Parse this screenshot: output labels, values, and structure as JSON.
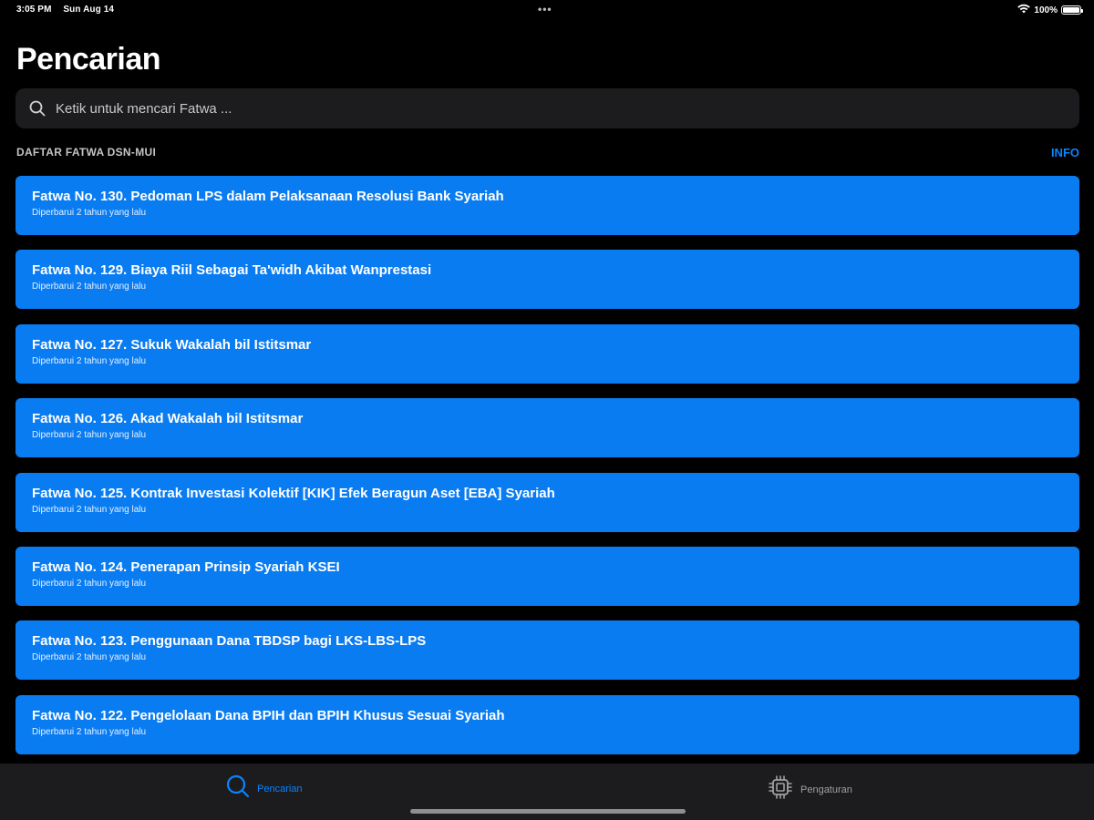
{
  "status_bar": {
    "time": "3:05 PM",
    "date": "Sun Aug 14",
    "dots": "•••",
    "battery": "100%",
    "battery_level": 1.0
  },
  "page": {
    "title": "Pencarian"
  },
  "search": {
    "placeholder": "Ketik untuk mencari Fatwa ...",
    "value": "",
    "icon": "search-icon"
  },
  "section": {
    "title": "DAFTAR FATWA DSN-MUI",
    "action": "INFO"
  },
  "fatwa_list": [
    {
      "title": "Fatwa No. 130. Pedoman LPS dalam Pelaksanaan Resolusi Bank Syariah",
      "subtitle": "Diperbarui 2 tahun yang lalu"
    },
    {
      "title": "Fatwa No. 129. Biaya Riil Sebagai Ta'widh Akibat Wanprestasi",
      "subtitle": "Diperbarui 2 tahun yang lalu"
    },
    {
      "title": "Fatwa No. 127. Sukuk Wakalah bil Istitsmar",
      "subtitle": "Diperbarui 2 tahun yang lalu"
    },
    {
      "title": "Fatwa No. 126. Akad Wakalah bil Istitsmar",
      "subtitle": "Diperbarui 2 tahun yang lalu"
    },
    {
      "title": "Fatwa No. 125. Kontrak Investasi Kolektif [KIK] Efek Beragun Aset [EBA] Syariah",
      "subtitle": "Diperbarui 2 tahun yang lalu"
    },
    {
      "title": "Fatwa No. 124. Penerapan Prinsip Syariah KSEI",
      "subtitle": "Diperbarui 2 tahun yang lalu"
    },
    {
      "title": "Fatwa No. 123. Penggunaan Dana TBDSP bagi LKS-LBS-LPS",
      "subtitle": "Diperbarui 2 tahun yang lalu"
    },
    {
      "title": "Fatwa No. 122. Pengelolaan Dana BPIH dan BPIH Khusus Sesuai Syariah",
      "subtitle": "Diperbarui 2 tahun yang lalu"
    }
  ],
  "tab_bar": {
    "tabs": [
      {
        "label": "Pencarian",
        "icon": "search-icon",
        "active": true
      },
      {
        "label": "Pengaturan",
        "icon": "chip-icon",
        "active": false
      }
    ]
  },
  "colors": {
    "accent": "#0a84ff",
    "card": "#0a7cf2",
    "background": "#000000",
    "surface": "#1c1c1e"
  }
}
